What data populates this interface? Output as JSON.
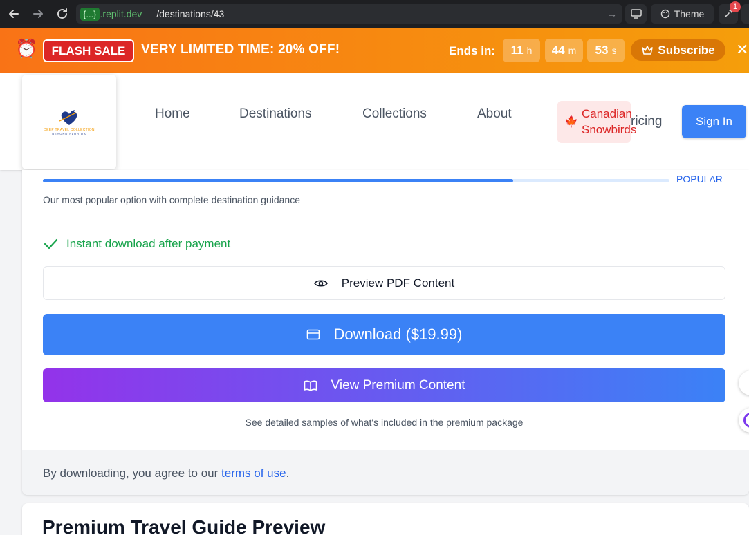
{
  "browser": {
    "url_chip": "{...}",
    "url_domain": ".replit.dev",
    "url_path": "/destinations/43",
    "theme_label": "Theme",
    "notification_count": "1"
  },
  "flash": {
    "badge": "FLASH SALE",
    "headline": "VERY LIMITED TIME:  20% OFF!",
    "ends_label": "Ends in:",
    "hours": "11",
    "hours_unit": "h",
    "minutes": "44",
    "minutes_unit": "m",
    "seconds": "53",
    "seconds_unit": "s",
    "subscribe_label": "Subscribe"
  },
  "logo": {
    "line1": "DEEP TRAVEL COLLECTION",
    "line2": "BEYOND FLORIDA"
  },
  "nav": {
    "home": "Home",
    "destinations": "Destinations",
    "collections": "Collections",
    "about": "About",
    "canadian_line1": "Canadian",
    "canadian_line2": "Snowbirds",
    "pricing_fragment": "ricing",
    "signin": "Sign In"
  },
  "plan": {
    "popular_label": "POPULAR",
    "progress_fraction": 0.75,
    "description": "Our most popular option with complete destination guidance",
    "instant_download": "Instant download after payment",
    "preview_button": "Preview PDF Content",
    "download_button": "Download ($19.99)",
    "premium_button": "View Premium Content",
    "samples_note": "See detailed samples of what's included in the premium package",
    "agree_prefix": "By downloading, you agree to our ",
    "agree_link": "terms of use",
    "agree_suffix": "."
  },
  "next_section": {
    "title": "Premium Travel Guide Preview"
  },
  "colors": {
    "flash_start": "#f97316",
    "flash_end": "#f59e0b",
    "primary": "#3b82f6",
    "premium_start": "#9333ea",
    "success": "#16a34a",
    "danger": "#dc2626"
  }
}
